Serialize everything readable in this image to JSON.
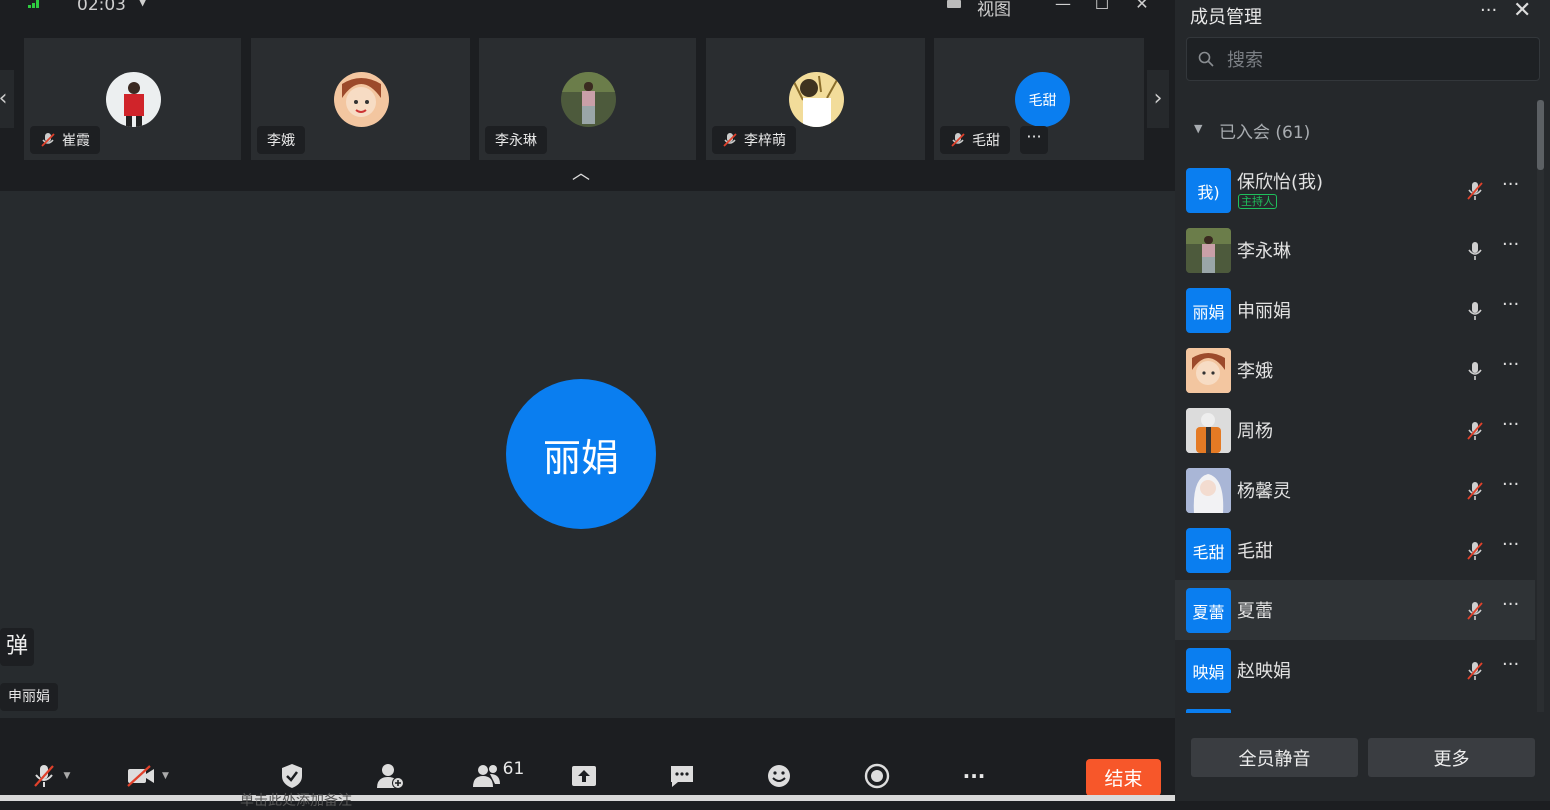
{
  "topbar": {
    "timer": "02:03",
    "view_label": "视图"
  },
  "thumbnails": [
    {
      "name": "崔霞",
      "muted": true,
      "avatar": "photo"
    },
    {
      "name": "李娥",
      "muted": false,
      "avatar": "photo"
    },
    {
      "name": "李永琳",
      "muted": false,
      "avatar": "photo"
    },
    {
      "name": "李梓萌",
      "muted": true,
      "avatar": "photo"
    },
    {
      "name": "毛甜",
      "muted": true,
      "avatar": "text",
      "avatar_text": "毛甜"
    }
  ],
  "stage": {
    "avatar_text": "丽娟",
    "danmu_label": "弹",
    "speaker_name": "申丽娟"
  },
  "toolbar": {
    "participants_count": "61",
    "end_label": "结束",
    "bottom_partial_text": "单击此处添加备注"
  },
  "panel": {
    "title": "成员管理",
    "search_placeholder": "搜索",
    "group_label": "已入会 (61)",
    "members": [
      {
        "name": "保欣怡(我)",
        "avatar_text": "我)",
        "host_tag": "主持人",
        "mic": "muted"
      },
      {
        "name": "李永琳",
        "avatar": "photo",
        "mic": "on"
      },
      {
        "name": "申丽娟",
        "avatar_text": "丽娟",
        "mic": "on"
      },
      {
        "name": "李娥",
        "avatar": "photo",
        "mic": "on"
      },
      {
        "name": "周杨",
        "avatar": "photo",
        "mic": "muted"
      },
      {
        "name": "杨馨灵",
        "avatar": "photo",
        "mic": "muted"
      },
      {
        "name": "毛甜",
        "avatar_text": "毛甜",
        "mic": "muted"
      },
      {
        "name": "夏蕾",
        "avatar_text": "夏蕾",
        "mic": "muted"
      },
      {
        "name": "赵映娟",
        "avatar_text": "映娟",
        "mic": "muted"
      }
    ],
    "mute_all_label": "全员静音",
    "more_label": "更多"
  },
  "colors": {
    "accent": "#0a7ef0",
    "end": "#f7572a",
    "host_tag": "#1fbf5c",
    "muted_slash": "#e0412b"
  }
}
